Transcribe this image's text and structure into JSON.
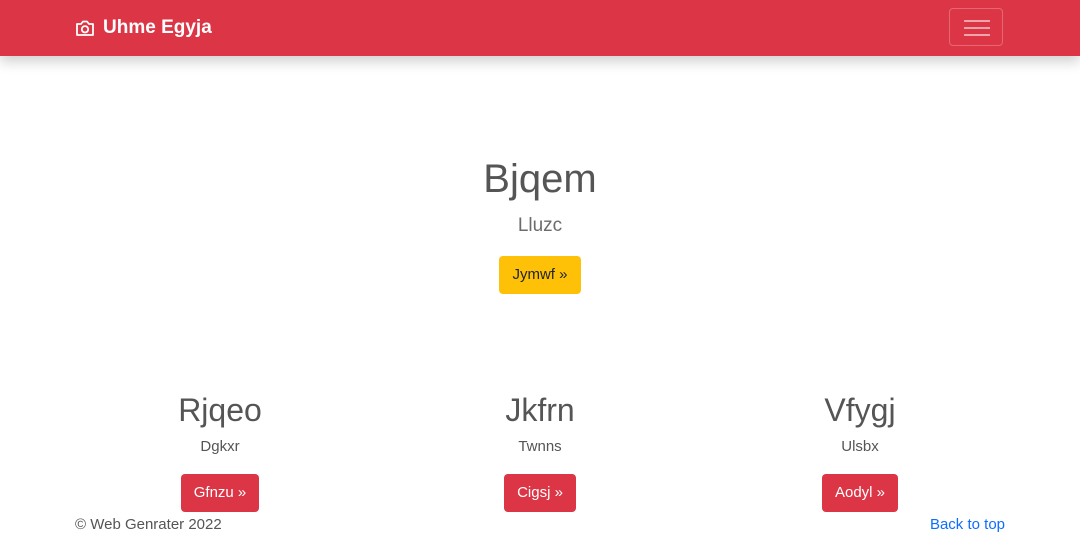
{
  "navbar": {
    "brand_text": "Uhme Egyja",
    "brand_icon": "camera-icon",
    "menu_icon": "hamburger-menu-icon",
    "background_color": "#dc3545"
  },
  "hero": {
    "title": "Bjqem",
    "subtitle": "Lluzc",
    "button_label": "Jymwf »",
    "button_color": "#ffc107"
  },
  "columns": [
    {
      "title": "Rjqeo",
      "text": "Dgkxr",
      "button_label": "Gfnzu »"
    },
    {
      "title": "Jkfrn",
      "text": "Twnns",
      "button_label": "Cigsj »"
    },
    {
      "title": "Vfygj",
      "text": "Ulsbx",
      "button_label": "Aodyl »"
    }
  ],
  "column_button_color": "#dc3545",
  "footer": {
    "copyright": "© Web Genrater 2022",
    "back_to_top": "Back to top",
    "link_color": "#0d6efd"
  }
}
